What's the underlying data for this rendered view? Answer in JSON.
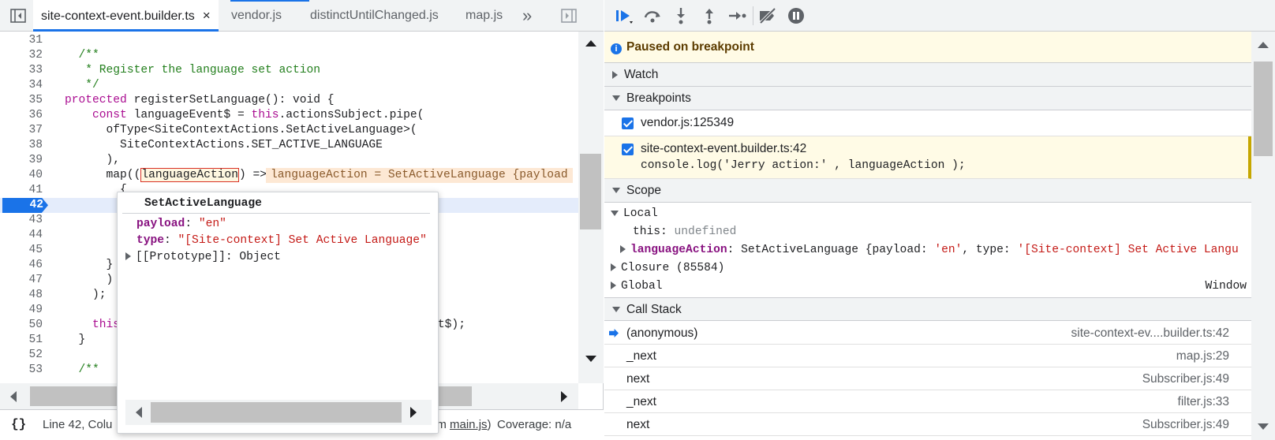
{
  "tabs": [
    {
      "label": "site-context-event.builder.ts",
      "active": true,
      "close": "×"
    },
    {
      "label": "vendor.js"
    },
    {
      "label": "distinctUntilChanged.js"
    },
    {
      "label": "map.js"
    }
  ],
  "tabs_more": "»",
  "code_lines": [
    {
      "n": "31",
      "text": ""
    },
    {
      "n": "32",
      "text": "  /**"
    },
    {
      "n": "33",
      "text": "   * Register the language set action"
    },
    {
      "n": "34",
      "text": "   */"
    },
    {
      "n": "35",
      "kw": "protected",
      "text": " registerSetLanguage(): void {"
    },
    {
      "n": "36",
      "kw": "    const",
      "text": " languageEvent$ = ",
      "this": "this",
      "rest": ".actionsSubject.pipe("
    },
    {
      "n": "37",
      "text": "      ofType<SiteContextActions.SetActiveLanguage>("
    },
    {
      "n": "38",
      "text": "        SiteContextActions.SET_ACTIVE_LANGUAGE"
    },
    {
      "n": "39",
      "text": "      ),"
    },
    {
      "n": "40",
      "pre": "      map((",
      "var": "languageAction",
      "post": ") =>",
      "inline": "languageAction = SetActiveLanguage {payload"
    },
    {
      "n": "41",
      "text": "        {"
    },
    {
      "n": "42",
      "text": "                                      on );"
    },
    {
      "n": "43",
      "text": ""
    },
    {
      "n": "44",
      "text": ""
    },
    {
      "n": "45",
      "text": "        });"
    },
    {
      "n": "46",
      "text": "      }"
    },
    {
      "n": "47",
      "text": "      )"
    },
    {
      "n": "48",
      "text": "    );"
    },
    {
      "n": "49",
      "text": ""
    },
    {
      "n": "50",
      "pre": "    ",
      "this": "this",
      "rest": ".e                                      geEvent$);"
    },
    {
      "n": "51",
      "text": "  }"
    },
    {
      "n": "52",
      "text": ""
    },
    {
      "n": "53",
      "text": "  /**"
    }
  ],
  "current_line": "42",
  "popover": {
    "title": "SetActiveLanguage",
    "payload_key": "payload",
    "payload_val": "\"en\"",
    "type_key": "type",
    "type_val": "\"[Site-context] Set Active Language\"",
    "proto": "[[Prototype]]: Object"
  },
  "status": {
    "braces": "{}",
    "position": "Line 42, Colu",
    "mapped_prefix": "rom",
    "mapped_file": "main.js",
    "mapped_suffix": ")",
    "coverage": "Coverage: n/a"
  },
  "debugger": {
    "paused_text": "Paused on breakpoint",
    "sections": {
      "watch": "Watch",
      "breakpoints": "Breakpoints",
      "scope": "Scope",
      "call_stack": "Call Stack"
    },
    "breakpoints": [
      {
        "label": "vendor.js:125349",
        "checked": true
      },
      {
        "label": "site-context-event.builder.ts:42",
        "code": "console.log('Jerry action:' , languageAction );",
        "checked": true
      }
    ],
    "scope": {
      "local_label": "Local",
      "this_key": "this",
      "this_val": "undefined",
      "action_key": "languageAction",
      "action_type": "SetActiveLanguage",
      "action_open": " {payload: ",
      "action_payload": "'en'",
      "action_mid": ", type: ",
      "action_type_val": "'[Site-context] Set Active Langu",
      "closure": "Closure (85584)",
      "global": "Global",
      "global_val": "Window"
    },
    "call_stack": [
      {
        "fn": "(anonymous)",
        "loc": "site-context-ev....builder.ts:42",
        "current": true
      },
      {
        "fn": "_next",
        "loc": "map.js:29"
      },
      {
        "fn": "next",
        "loc": "Subscriber.js:49"
      },
      {
        "fn": "_next",
        "loc": "filter.js:33"
      },
      {
        "fn": "next",
        "loc": "Subscriber.js:49"
      }
    ]
  },
  "colors": {
    "accent": "#1a73e8",
    "paused_bg": "#fffbe6",
    "current_line_bg": "#e4ecfb"
  }
}
